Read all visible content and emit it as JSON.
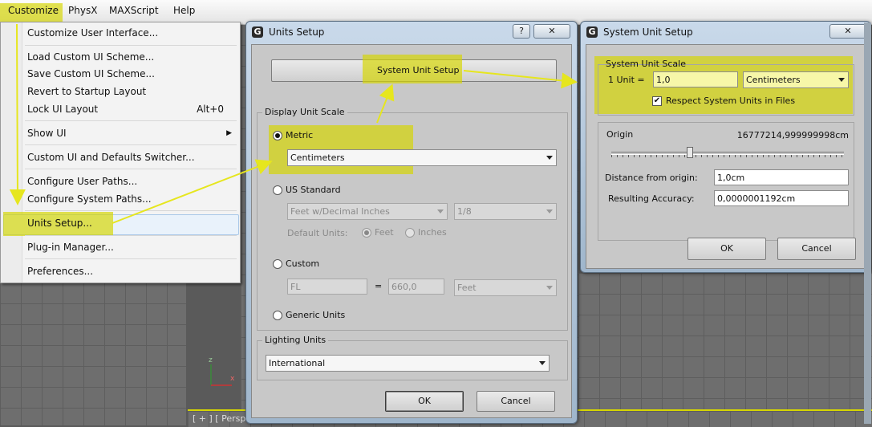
{
  "menubar": {
    "items": [
      "Customize",
      "PhysX",
      "MAXScript",
      "Help"
    ]
  },
  "customize_menu": {
    "items": [
      {
        "label": "Customize User Interface...",
        "shortcut": ""
      },
      {
        "label": "Load Custom UI Scheme...",
        "shortcut": ""
      },
      {
        "label": "Save Custom UI Scheme...",
        "shortcut": ""
      },
      {
        "label": "Revert to Startup Layout",
        "shortcut": ""
      },
      {
        "label": "Lock UI Layout",
        "shortcut": "Alt+0"
      },
      {
        "label": "Show UI",
        "shortcut": ""
      },
      {
        "label": "Custom UI and Defaults Switcher...",
        "shortcut": ""
      },
      {
        "label": "Configure User Paths...",
        "shortcut": ""
      },
      {
        "label": "Configure System Paths...",
        "shortcut": ""
      },
      {
        "label": "Units Setup...",
        "shortcut": ""
      },
      {
        "label": "Plug-in Manager...",
        "shortcut": ""
      },
      {
        "label": "Preferences...",
        "shortcut": ""
      }
    ]
  },
  "units_setup": {
    "title": "Units Setup",
    "help_btn": "?",
    "close_btn": "✕",
    "system_unit_setup_button": "System Unit Setup",
    "display_unit_scale": {
      "label": "Display Unit Scale",
      "metric_label": "Metric",
      "metric_value": "Centimeters",
      "us_standard_label": "US Standard",
      "us_value": "Feet w/Decimal Inches",
      "us_fraction": "1/8",
      "default_units_label": "Default Units:",
      "feet_label": "Feet",
      "inches_label": "Inches",
      "custom_label": "Custom",
      "custom_name": "FL",
      "custom_equals": "=",
      "custom_value": "660,0",
      "custom_unit": "Feet",
      "generic_label": "Generic Units"
    },
    "lighting_units": {
      "label": "Lighting Units",
      "value": "International"
    },
    "ok_label": "OK",
    "cancel_label": "Cancel"
  },
  "system_unit_setup": {
    "title": "System Unit Setup",
    "close_btn": "✕",
    "scale_group_label": "System Unit Scale",
    "one_unit_label": "1 Unit =",
    "one_unit_value": "1,0",
    "unit_value": "Centimeters",
    "respect_label": "Respect System Units in Files",
    "respect_checked": true,
    "origin_label": "Origin",
    "origin_value": "16777214,999999998cm",
    "slider_position": 0.33,
    "distance_label": "Distance from origin:",
    "distance_value": "1,0cm",
    "accuracy_label": "Resulting Accuracy:",
    "accuracy_value": "0,0000001192cm",
    "ok_label": "OK",
    "cancel_label": "Cancel"
  },
  "viewport": {
    "label": "[ + ] [ Perspe",
    "axis_z": "z",
    "axis_x": "x"
  },
  "colors": {
    "highlight": "#d6d600",
    "arrow": "#e6e61e",
    "dialog_frame": "#a9bfd4",
    "panel": "#c8c8c8"
  }
}
